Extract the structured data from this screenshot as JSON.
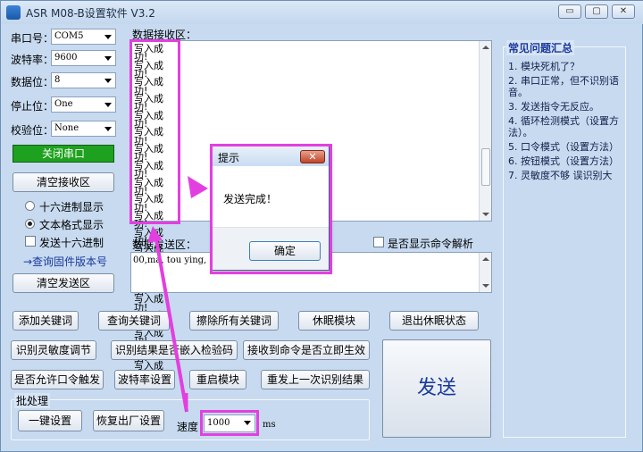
{
  "window": {
    "title": "ASR M08-B设置软件 V3.2",
    "min": "▭",
    "max": "▢",
    "close": "✕"
  },
  "settings": {
    "port_label": "串口号：",
    "port_value": "COM5",
    "baud_label": "波特率：",
    "baud_value": "9600",
    "data_label": "数据位：",
    "data_value": "8",
    "stop_label": "停止位：",
    "stop_value": "One",
    "parity_label": "校验位：",
    "parity_value": "None",
    "close_port_label": "关闭串口",
    "clear_receive_label": "清空接收区",
    "hex_display_label": "十六进制显示",
    "text_display_label": "文本格式显示",
    "send_hex_label": "发送十六进制",
    "query_firmware_label": "→查询固件版本号",
    "clear_send_label": "清空发送区"
  },
  "receive": {
    "label": "数据接收区：",
    "lines": [
      "写入成功!",
      "写入成功!",
      "写入成功!",
      "写入成功!",
      "写入成功!",
      "写入成功!",
      "写入成功!",
      "写入成功!",
      "写入成功!",
      "写入成功!",
      "写入成功!",
      "写入成功!",
      "写入成功!",
      "写入成功!",
      "写入成功!",
      "写入成功!",
      "写入成功!",
      "写入成功!",
      "写入成功!",
      "写入成功!"
    ]
  },
  "send": {
    "label": "数据发送区：",
    "text": "00,ma, tou ying,",
    "show_parse_label": "是否显示命令解析"
  },
  "dialog": {
    "title": "提示",
    "message": "发送完成！",
    "ok_label": "确定",
    "close_glyph": "✕"
  },
  "faq": {
    "title": "常见问题汇总",
    "items": [
      "1. 模块死机了？",
      "2. 串口正常，但不识别语音。",
      "3. 发送指令无反应。",
      "4. 循环检测模式（设置方法）。",
      "5. 口令模式（设置方法）",
      "6. 按钮模式（设置方法）",
      "7. 灵敏度不够 误识别大"
    ]
  },
  "actions": {
    "add_keyword": "添加关键词",
    "query_keyword": "查询关键词",
    "erase_keywords": "擦除所有关键词",
    "sleep_module": "休眠模块",
    "exit_sleep": "退出休眠状态",
    "sensitivity": "识别灵敏度调节",
    "result_to_check": "识别结果是否嵌入检验码",
    "cmd_immediate": "接收到命令是否立即生效",
    "allow_trigger": "是否允许口令触发",
    "baud_setting": "波特率设置",
    "restart_module": "重启模块",
    "resend_last": "重发上一次识别结果",
    "send": "发送"
  },
  "batch": {
    "title": "批处理",
    "one_key": "一键设置",
    "factory_reset": "恢复出厂设置",
    "speed_label": "速度",
    "speed_value": "1000",
    "speed_unit": "ms"
  },
  "colors": {
    "highlight": "#e33fe0",
    "accent_text": "#1a3a9c",
    "send_text": "#1a3a9c",
    "green_button": "#1ea11e"
  }
}
